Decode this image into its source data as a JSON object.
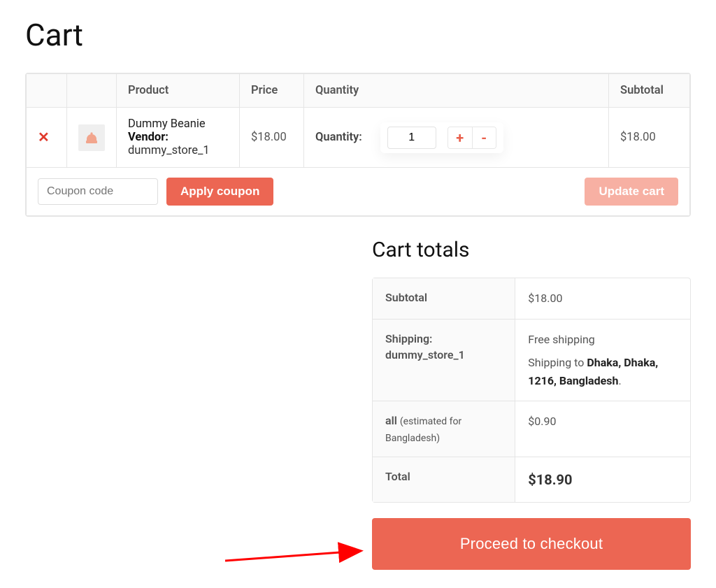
{
  "page_title": "Cart",
  "headers": {
    "product": "Product",
    "price": "Price",
    "quantity": "Quantity",
    "subtotal": "Subtotal"
  },
  "item": {
    "name": "Dummy Beanie",
    "vendor_label": "Vendor:",
    "vendor": "dummy_store_1",
    "price": "$18.00",
    "qty_label": "Quantity:",
    "qty_value": "1",
    "subtotal": "$18.00"
  },
  "actions": {
    "coupon_placeholder": "Coupon code",
    "apply_coupon": "Apply coupon",
    "update_cart": "Update cart"
  },
  "totals": {
    "title": "Cart totals",
    "subtotal_label": "Subtotal",
    "subtotal_value": "$18.00",
    "shipping_label_1": "Shipping:",
    "shipping_label_2": "dummy_store_1",
    "free_shipping": "Free shipping",
    "shipping_to_prefix": "Shipping to ",
    "shipping_to_bold": "Dhaka, Dhaka, 1216, Bangladesh",
    "shipping_to_suffix": ".",
    "tax_label_main": "all ",
    "tax_label_sub": "(estimated for Bangladesh)",
    "tax_value": "$0.90",
    "total_label": "Total",
    "total_value": "$18.90",
    "checkout": "Proceed to checkout"
  }
}
